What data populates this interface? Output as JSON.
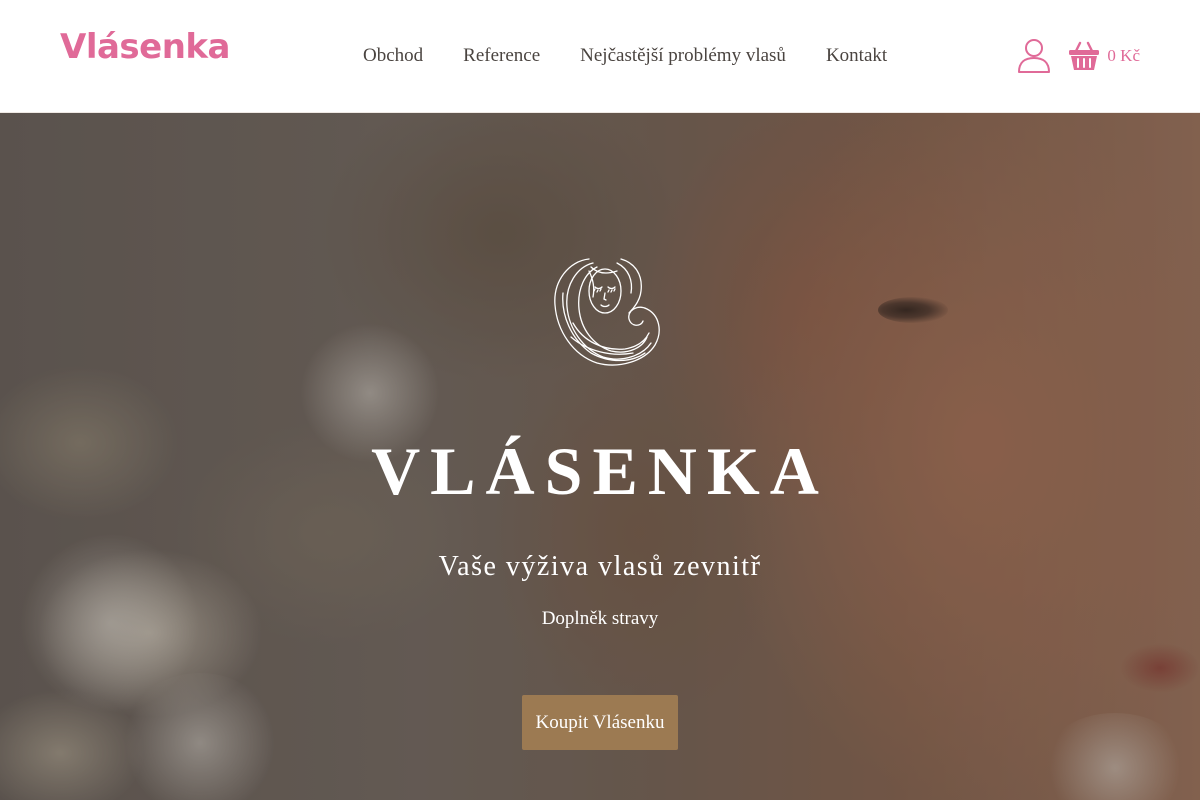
{
  "header": {
    "logo": "Vlásenka",
    "nav": [
      {
        "label": "Obchod"
      },
      {
        "label": "Reference"
      },
      {
        "label": "Nejčastější problémy vlasů"
      },
      {
        "label": "Kontakt"
      }
    ],
    "user_icon": "user-icon",
    "cart_icon": "basket-icon",
    "cart_total": "0 Kč"
  },
  "hero": {
    "emblem_icon": "woman-hair-emblem-icon",
    "title": "VLÁSENKA",
    "subtitle": "Vaše výživa vlasů zevnitř",
    "tagline": "Doplněk stravy",
    "cta_label": "Koupit Vlásenku"
  },
  "colors": {
    "brand_pink": "#e06a98",
    "nav_text": "#4a4440",
    "cta_background": "#9c7a52",
    "hero_text": "#ffffff"
  }
}
